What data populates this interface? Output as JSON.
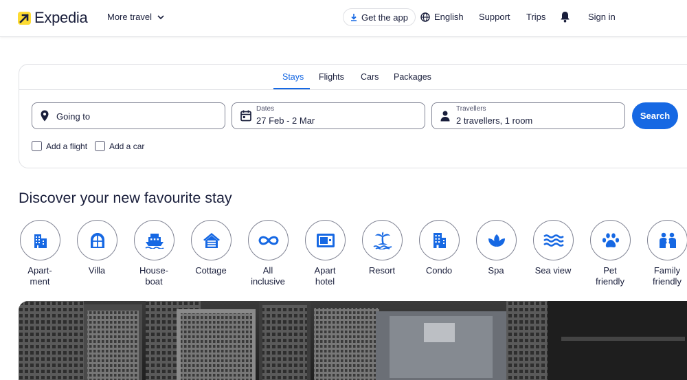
{
  "header": {
    "brand": "Expedia",
    "more_travel": "More travel",
    "get_app": "Get the app",
    "language": "English",
    "support": "Support",
    "trips": "Trips",
    "sign_in": "Sign in"
  },
  "search": {
    "tabs": [
      {
        "label": "Stays",
        "active": true
      },
      {
        "label": "Flights",
        "active": false
      },
      {
        "label": "Cars",
        "active": false
      },
      {
        "label": "Packages",
        "active": false
      }
    ],
    "going_to_placeholder": "Going to",
    "dates_label": "Dates",
    "dates_value": "27 Feb - 2 Mar",
    "travellers_label": "Travellers",
    "travellers_value": "2 travellers, 1 room",
    "search_button": "Search",
    "add_flight": "Add a flight",
    "add_car": "Add a car"
  },
  "discover": {
    "title": "Discover your new favourite stay",
    "categories": [
      {
        "label": "Apart-\nment",
        "icon": "apartment-icon"
      },
      {
        "label": "Villa",
        "icon": "villa-icon"
      },
      {
        "label": "House-\nboat",
        "icon": "houseboat-icon"
      },
      {
        "label": "Cottage",
        "icon": "cottage-icon"
      },
      {
        "label": "All\ninclusive",
        "icon": "infinity-icon"
      },
      {
        "label": "Apart\nhotel",
        "icon": "aparthotel-icon"
      },
      {
        "label": "Resort",
        "icon": "palm-island-icon"
      },
      {
        "label": "Condo",
        "icon": "condo-icon"
      },
      {
        "label": "Spa",
        "icon": "lotus-icon"
      },
      {
        "label": "Sea view",
        "icon": "waves-icon"
      },
      {
        "label": "Pet\nfriendly",
        "icon": "paw-icon"
      },
      {
        "label": "Family\nfriendly",
        "icon": "family-icon"
      }
    ]
  },
  "colors": {
    "accent": "#1668e3",
    "brand_yellow": "#fddb32",
    "text": "#191e3b",
    "border": "#818494"
  }
}
